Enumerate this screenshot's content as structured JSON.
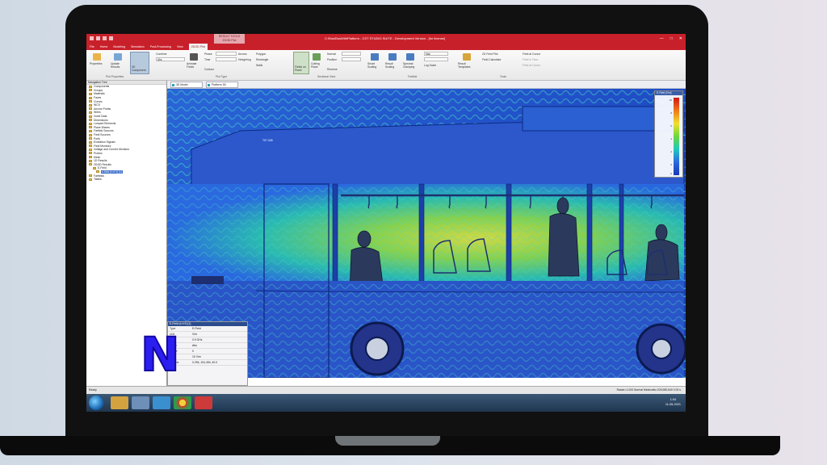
{
  "window": {
    "title": "C:\\Bus\\BusWithPlatform - CST STUDIO SUITE - Development Version - [for license]",
    "context_tab": "RESULT TOOLS",
    "context_sub": "2D/3D Plot",
    "controls": [
      "—",
      "□",
      "✕"
    ]
  },
  "tabs": [
    "File",
    "Home",
    "Modeling",
    "Simulation",
    "Post-Processing",
    "View",
    "2D/3D Plot"
  ],
  "ribbon": {
    "groups": [
      {
        "label": "Plot Properties",
        "buttons": [
          "Properties",
          "Update Results",
          "3D Component"
        ]
      },
      {
        "label": "Plot Type",
        "buttons": [
          "Combine",
          "Abs",
          "Animate Fields",
          "Phase",
          "Time",
          "Contour",
          "Arrows",
          "Hedgehog",
          "Polygon",
          "Rectangle",
          "Walls"
        ]
      },
      {
        "label": "Sectional View",
        "buttons": [
          "Fields on Plane",
          "Cutting Plane",
          "Normal",
          "Position",
          "Reverse"
        ]
      },
      {
        "label": "Farfield",
        "buttons": [
          "Smart Scaling",
          "Result Scaling",
          "Spectral Clamping",
          "Max",
          "Log Scale"
        ]
      },
      {
        "label": "Tools",
        "buttons": [
          "Result Templates",
          "2D Field Plot",
          "Field Calculator",
          "Field at Cursor",
          "Field in Time",
          "Field at Cursor"
        ]
      }
    ]
  },
  "navigation_tree": {
    "header": "Navigation Tree",
    "items": [
      "Components",
      "Groups",
      "Materials",
      "Faces",
      "Curves",
      "WCS",
      "Anchor Points",
      "Wires",
      "Voxel Data",
      "Dimensions",
      "Lumped Elements",
      "Plane Waves",
      "Farfield Sources",
      "Field Sources",
      "Ports",
      "Excitation Signals",
      "Field Monitors",
      "Voltage and Current Monitors",
      "Probes",
      "Mesh",
      "1D Results",
      "2D/3D Results",
      "E-Field",
      "e-field (f=0.9) [1]",
      "Farfields",
      "Tables"
    ],
    "selected": "e-field (f=0.9) [1]"
  },
  "doc_tabs": [
    "3D Model",
    "Platform 3D"
  ],
  "legend": {
    "title": "E-Field [V/m]",
    "ticks": [
      "10",
      "8",
      "6",
      "4",
      "2",
      "0",
      "-2"
    ]
  },
  "properties": {
    "header": "E-Field (f=0.9) [1]",
    "rows": [
      {
        "k": "Type",
        "v": "E-Field"
      },
      {
        "k": "Unit",
        "v": "V/m"
      },
      {
        "k": "Freq",
        "v": "0.9 GHz"
      },
      {
        "k": "Comp",
        "v": "Abs"
      },
      {
        "k": "Phase",
        "v": "0"
      },
      {
        "k": "Max",
        "v": "10 V/m"
      },
      {
        "k": "Sample",
        "v": "0.294, 104.494, 40.0"
      }
    ]
  },
  "labels": {
    "bus_plate": "T07-345"
  },
  "status": {
    "left": "Ready",
    "right": "Raster=1.000  Normal  Meshcells=226,980,640  0.00 s"
  },
  "clock": {
    "time": "1:04",
    "date": "11-05-2021"
  },
  "logo": "N",
  "colors": {
    "accent": "#c8202a",
    "logo": "#2a1ef0"
  }
}
